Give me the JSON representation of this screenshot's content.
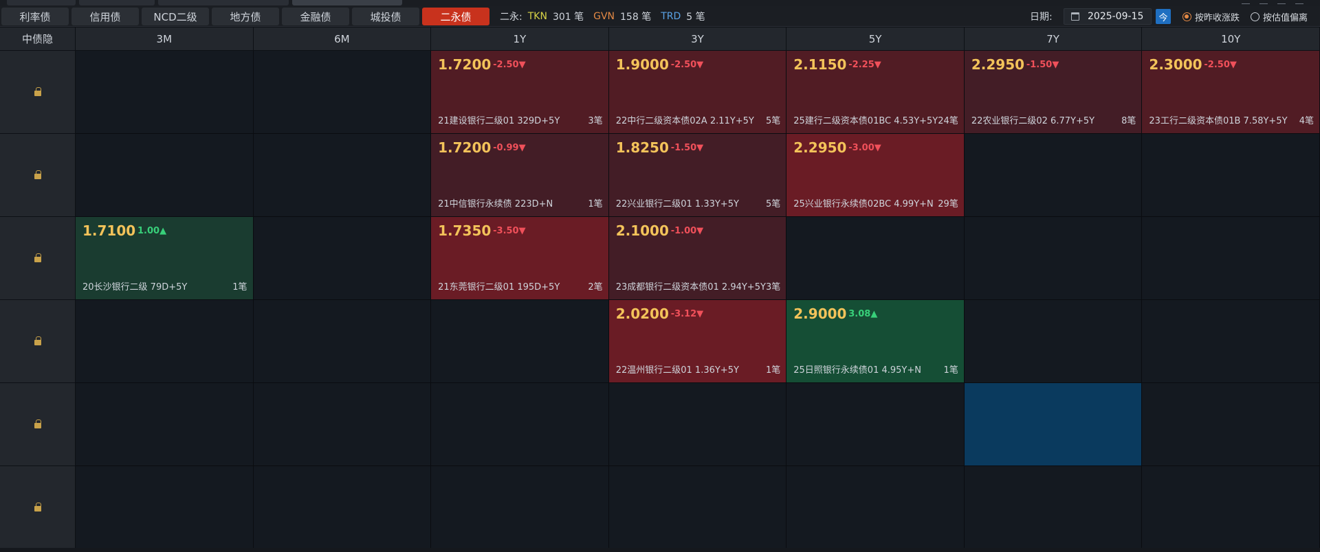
{
  "tabs": [
    {
      "label": "利率债",
      "active": false
    },
    {
      "label": "信用债",
      "active": false
    },
    {
      "label": "NCD二级",
      "active": false
    },
    {
      "label": "地方债",
      "active": false
    },
    {
      "label": "金融债",
      "active": false
    },
    {
      "label": "城投债",
      "active": false
    },
    {
      "label": "二永债",
      "active": true
    }
  ],
  "stats": {
    "prefix": "二永:",
    "tkn_label": "TKN",
    "tkn_count": "301 笔",
    "gvn_label": "GVN",
    "gvn_count": "158 笔",
    "trd_label": "TRD",
    "trd_count": "5 笔"
  },
  "date": {
    "label": "日期:",
    "value": "2025-09-15",
    "today_button": "今"
  },
  "options": [
    {
      "label": "按昨收涨跌",
      "selected": true
    },
    {
      "label": "按估值偏离",
      "selected": false
    }
  ],
  "grid": {
    "corner_label": "中债隐",
    "columns": [
      "3M",
      "6M",
      "1Y",
      "3Y",
      "5Y",
      "7Y",
      "10Y"
    ],
    "rows": [
      [
        null,
        null,
        {
          "rate": "1.7200",
          "change": "-2.50▼",
          "dir": "down",
          "bond": "21建设银行二级01 329D+5Y",
          "count": "3笔",
          "tone": "red2"
        },
        {
          "rate": "1.9000",
          "change": "-2.50▼",
          "dir": "down",
          "bond": "22中行二级资本债02A 2.11Y+5Y",
          "count": "5笔",
          "tone": "red2"
        },
        {
          "rate": "2.1150",
          "change": "-2.25▼",
          "dir": "down",
          "bond": "25建行二级资本债01BC 4.53Y+5Y",
          "count": "24笔",
          "tone": "red2"
        },
        {
          "rate": "2.2950",
          "change": "-1.50▼",
          "dir": "down",
          "bond": "22农业银行二级02 6.77Y+5Y",
          "count": "8笔",
          "tone": "red3"
        },
        {
          "rate": "2.3000",
          "change": "-2.50▼",
          "dir": "down",
          "bond": "23工行二级资本债01B 7.58Y+5Y",
          "count": "4笔",
          "tone": "red2"
        }
      ],
      [
        null,
        null,
        {
          "rate": "1.7200",
          "change": "-0.99▼",
          "dir": "down",
          "bond": "21中信银行永续债 223D+N",
          "count": "1笔",
          "tone": "red3"
        },
        {
          "rate": "1.8250",
          "change": "-1.50▼",
          "dir": "down",
          "bond": "22兴业银行二级01 1.33Y+5Y",
          "count": "5笔",
          "tone": "red3"
        },
        {
          "rate": "2.2950",
          "change": "-3.00▼",
          "dir": "down",
          "bond": "25兴业银行永续债02BC 4.99Y+N",
          "count": "29笔",
          "tone": "red1"
        },
        null,
        null
      ],
      [
        {
          "rate": "1.7100",
          "change": "1.00▲",
          "dir": "up",
          "bond": "20长沙银行二级 79D+5Y",
          "count": "1笔",
          "tone": "green2"
        },
        null,
        {
          "rate": "1.7350",
          "change": "-3.50▼",
          "dir": "down",
          "bond": "21东莞银行二级01 195D+5Y",
          "count": "2笔",
          "tone": "red1"
        },
        {
          "rate": "2.1000",
          "change": "-1.00▼",
          "dir": "down",
          "bond": "23成都银行二级资本债01 2.94Y+5Y",
          "count": "3笔",
          "tone": "red3"
        },
        null,
        null,
        null
      ],
      [
        null,
        null,
        null,
        {
          "rate": "2.0200",
          "change": "-3.12▼",
          "dir": "down",
          "bond": "22温州银行二级01 1.36Y+5Y",
          "count": "1笔",
          "tone": "red1"
        },
        {
          "rate": "2.9000",
          "change": "3.08▲",
          "dir": "up",
          "bond": "25日照银行永续债01 4.95Y+N",
          "count": "1笔",
          "tone": "green1"
        },
        null,
        null
      ],
      [
        null,
        null,
        null,
        null,
        null,
        {
          "highlight": true
        },
        null
      ],
      [
        null,
        null,
        null,
        null,
        null,
        null,
        null
      ]
    ]
  }
}
